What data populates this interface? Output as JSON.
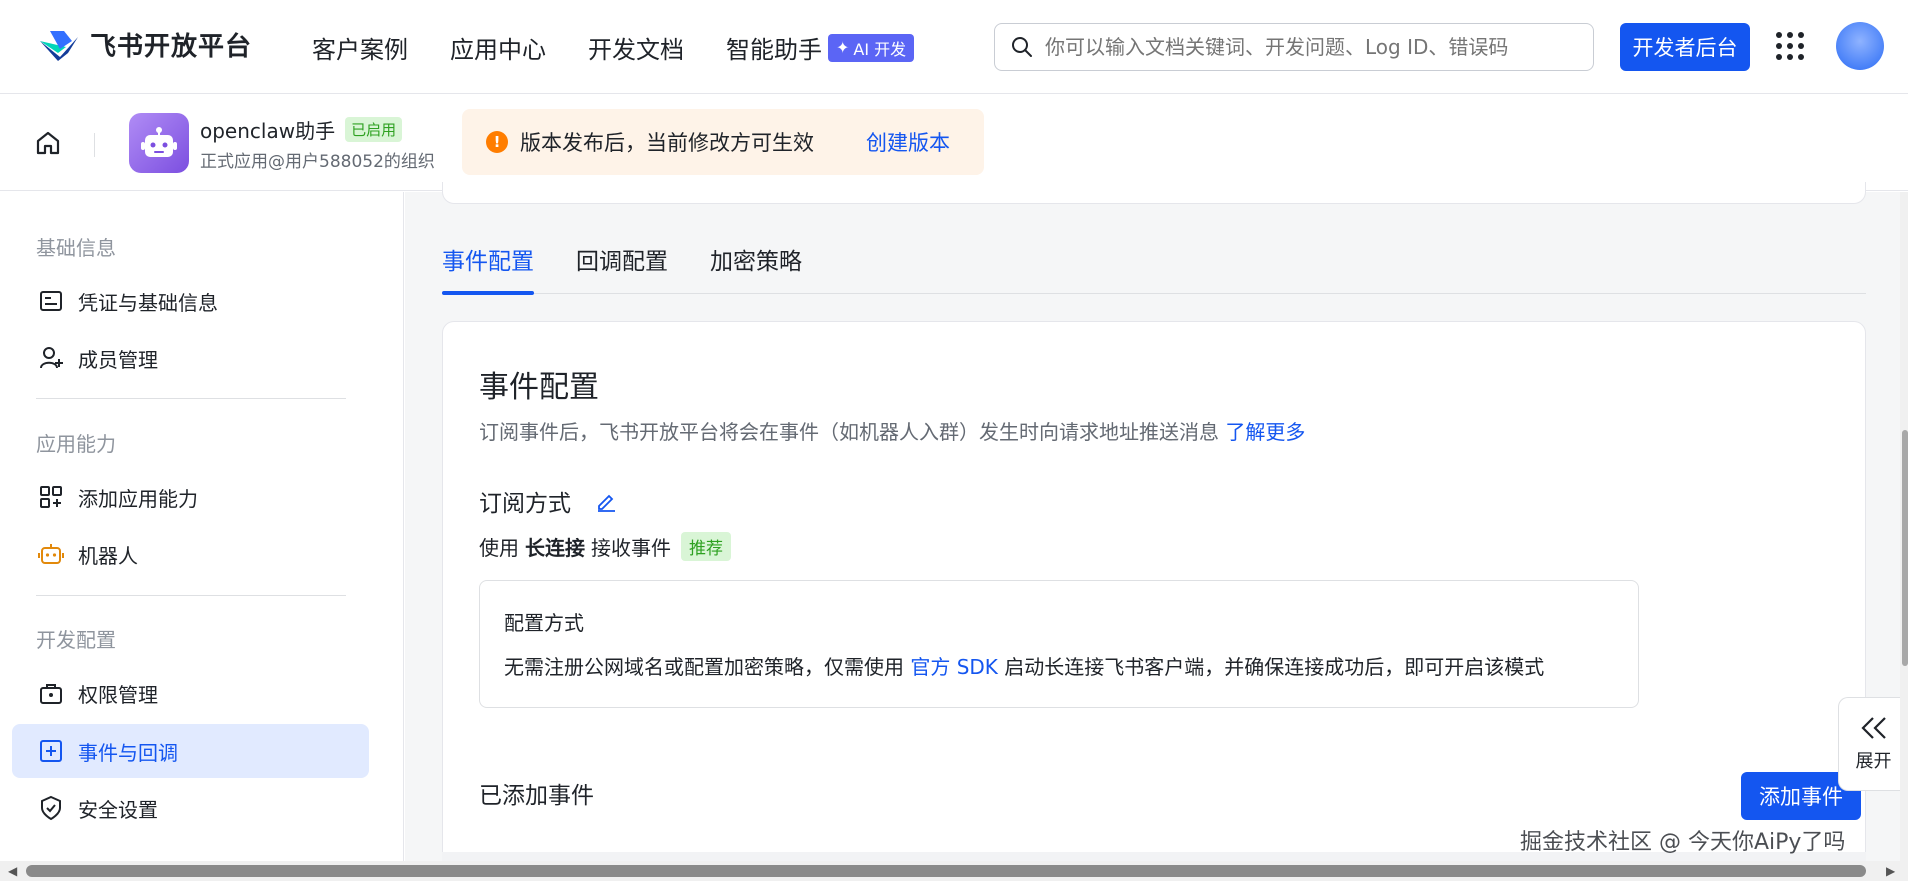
{
  "brand": {
    "name": "飞书开放平台"
  },
  "nav": {
    "items": [
      "客户案例",
      "应用中心",
      "开发文档",
      "智能助手"
    ],
    "ai_badge": "AI 开发"
  },
  "search": {
    "placeholder": "你可以输入文档关键词、开发问题、Log ID、错误码"
  },
  "header": {
    "dev_console": "开发者后台"
  },
  "app": {
    "name": "openclaw助手",
    "status": "已启用",
    "subtitle": "正式应用@用户588052的组织"
  },
  "notice": {
    "text": "版本发布后，当前修改方可生效",
    "action": "创建版本"
  },
  "sidebar": {
    "sections": [
      {
        "title": "基础信息",
        "items": [
          {
            "label": "凭证与基础信息",
            "icon": "credential-icon"
          },
          {
            "label": "成员管理",
            "icon": "member-add-icon"
          }
        ]
      },
      {
        "title": "应用能力",
        "items": [
          {
            "label": "添加应用能力",
            "icon": "apps-add-icon"
          },
          {
            "label": "机器人",
            "icon": "robot-icon"
          }
        ]
      },
      {
        "title": "开发配置",
        "items": [
          {
            "label": "权限管理",
            "icon": "lock-icon"
          },
          {
            "label": "事件与回调",
            "icon": "event-icon",
            "active": true
          },
          {
            "label": "安全设置",
            "icon": "shield-icon"
          }
        ]
      }
    ]
  },
  "tabs": [
    {
      "label": "事件配置",
      "active": true
    },
    {
      "label": "回调配置"
    },
    {
      "label": "加密策略"
    }
  ],
  "card": {
    "title": "事件配置",
    "desc": "订阅事件后，飞书开放平台将会在事件（如机器人入群）发生时向请求地址推送消息",
    "learn_more": "了解更多",
    "sub_title": "订阅方式",
    "line_prefix": "使用",
    "line_bold": "长连接",
    "line_suffix": "接收事件",
    "rec_tag": "推荐",
    "box_title": "配置方式",
    "box_text_a": "无需注册公网域名或配置加密策略，仅需使用",
    "box_link": "官方 SDK",
    "box_text_b": "启动长连接飞书客户端，并确保连接成功后，即可开启该模式",
    "added_title": "已添加事件",
    "add_button": "添加事件"
  },
  "expand": {
    "label": "展开"
  },
  "watermark": "掘金技术社区 @ 今天你AiPy了吗",
  "colors": {
    "primary": "#1456f0",
    "active_bg": "#e1eaff",
    "notice_bg": "#fef3e8",
    "warn": "#ff7d00",
    "success": "#2ea121"
  }
}
